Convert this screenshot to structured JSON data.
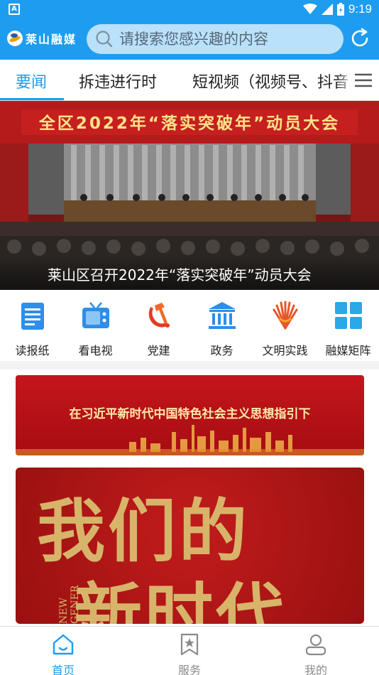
{
  "status_bar": {
    "time": "9:19",
    "indicator": "A"
  },
  "header": {
    "app_name": "莱山融媒",
    "search_placeholder": "请搜索您感兴趣的内容"
  },
  "tabs": [
    {
      "label": "要闻",
      "active": true
    },
    {
      "label": "拆违进行时",
      "active": false
    },
    {
      "label": "短视频（视频号、抖音",
      "active": false
    }
  ],
  "banner": {
    "slogan": "全区2022年“落实突破年”动员大会",
    "caption": "莱山区召开2022年“落实突破年”动员大会"
  },
  "quick_links": [
    {
      "label": "读报纸",
      "icon": "newspaper-icon"
    },
    {
      "label": "看电视",
      "icon": "tv-icon"
    },
    {
      "label": "党建",
      "icon": "party-emblem-icon"
    },
    {
      "label": "政务",
      "icon": "government-building-icon"
    },
    {
      "label": "文明实践",
      "icon": "civilization-practice-icon"
    },
    {
      "label": "融媒矩阵",
      "icon": "matrix-grid-icon"
    }
  ],
  "cards": {
    "card1_text": "在习近平新时代中国特色社会主义思想指引下",
    "card2_line1": "我们的",
    "card2_line2": "新时代",
    "card2_side": "NEW GENER"
  },
  "bottom_nav": [
    {
      "label": "首页",
      "icon": "home-icon",
      "active": true
    },
    {
      "label": "服务",
      "icon": "star-bookmark-icon",
      "active": false
    },
    {
      "label": "我的",
      "icon": "user-icon",
      "active": false
    }
  ],
  "colors": {
    "brand": "#1e9cf0",
    "search_bg": "#b9e1fb",
    "banner_red": "#c4161c",
    "gold": "#d7b46a"
  }
}
